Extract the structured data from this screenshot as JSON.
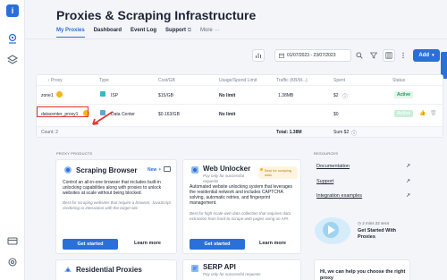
{
  "page": {
    "title": "Proxies & Scraping Infrastructure"
  },
  "tabs": [
    {
      "label": "My Proxies"
    },
    {
      "label": "Dashboard"
    },
    {
      "label": "Event Log"
    },
    {
      "label": "Support"
    },
    {
      "label": "More"
    }
  ],
  "toolbar": {
    "date_range": "01/07/2023 - 23/07/2023",
    "add_label": "Add"
  },
  "table": {
    "headers": [
      "Proxy",
      "Type",
      "Cost/GB",
      "Usage/Spend Limit",
      "Traffic (KB/M...)",
      "Spent",
      "Status"
    ],
    "rows": [
      {
        "proxy": "zone1",
        "type": "ISP",
        "cost": "$15/GB",
        "limit": "No limit",
        "traffic": "1.38MB",
        "spent": "$2",
        "status": "Active"
      },
      {
        "proxy": "datacenter_proxy1",
        "type": "Data Center",
        "cost": "$0.163/GB",
        "limit": "No limit",
        "traffic": "",
        "spent": "$0",
        "status": "Active"
      }
    ],
    "footer": {
      "count": "Count: 2",
      "traffic_total": "Total: 1.38M",
      "sum": "Sum $2"
    }
  },
  "products": {
    "section_label": "PROXY PRODUCTS",
    "scraping_browser": {
      "title": "Scraping Browser",
      "badge": "New",
      "desc": "Control an all-in-one browser that includes built-in unlocking capabilities along with proxies to unlock websites at scale without being blocked.",
      "best": "Best for scraping websites that require a browser, JavaScript rendering or interaction with the target site",
      "primary": "Get started",
      "secondary": "Learn more"
    },
    "web_unlocker": {
      "title": "Web Unlocker",
      "subtitle": "Pay only for successful requests",
      "badge": "Best for scraping data",
      "desc": "Automated website unlocking system that leverages the residential network and includes CAPTCHA solving, automatic retries, and fingerprint management.",
      "best": "Best for high-scale web data collection that requires data extraction from hard-to-scrape web pages using an API.",
      "primary": "Get started",
      "secondary": "Learn more"
    },
    "residential": {
      "title": "Residential Proxies"
    },
    "serp": {
      "title": "SERP API",
      "subtitle": "Pay only for successful requests"
    }
  },
  "resources": {
    "section_label": "RESOURCES",
    "links": [
      "Documentation",
      "Support",
      "Integration examples"
    ],
    "video": {
      "duration": "2 mins 22 secs",
      "title": "Get Started With Proxies"
    },
    "chat": {
      "text": "Hi, we can help you choose the right proxy"
    }
  },
  "colors": {
    "accent": "#2b6fd8",
    "active_green": "#1b9b5a",
    "highlight_red": "#e2352f"
  }
}
